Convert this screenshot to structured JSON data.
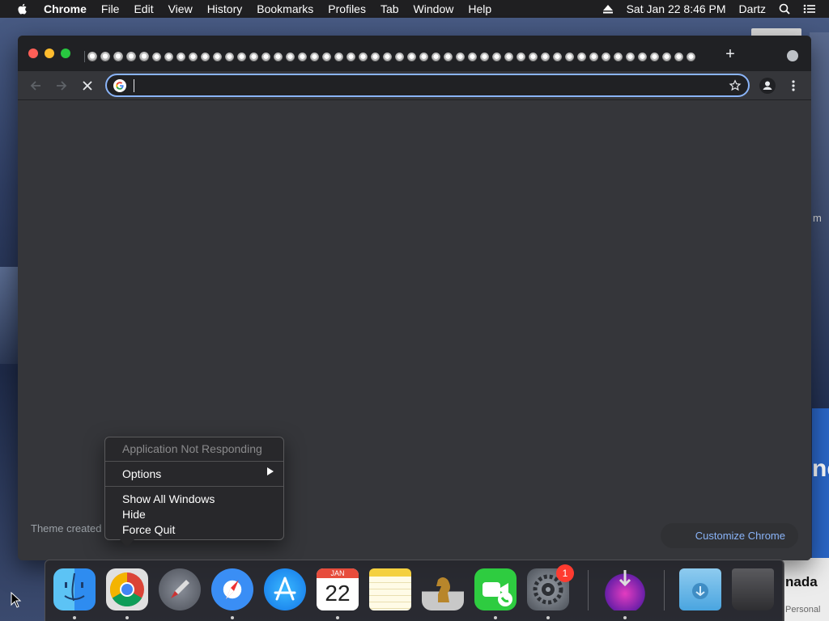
{
  "menubar": {
    "app_name": "Chrome",
    "items": [
      "File",
      "Edit",
      "View",
      "History",
      "Bookmarks",
      "Profiles",
      "Tab",
      "Window",
      "Help"
    ],
    "clock": "Sat Jan 22  8:46 PM",
    "user": "Dartz"
  },
  "browser": {
    "omnibox": {
      "value": "",
      "placeholder": ""
    },
    "tab_count_visible": 50
  },
  "content": {
    "theme_text": "Theme created",
    "customize_label": "Customize Chrome"
  },
  "context_menu": {
    "title": "Application Not Responding",
    "options": "Options",
    "show_all": "Show All Windows",
    "hide": "Hide",
    "force_quit": "Force Quit"
  },
  "dock": {
    "calendar_month": "JAN",
    "calendar_day": "22",
    "settings_badge": "1"
  },
  "desktop": {
    "right_window_text": "ne",
    "right_card_title": "nada",
    "right_card_sub": "Personal",
    "right_side_letter": "m"
  }
}
